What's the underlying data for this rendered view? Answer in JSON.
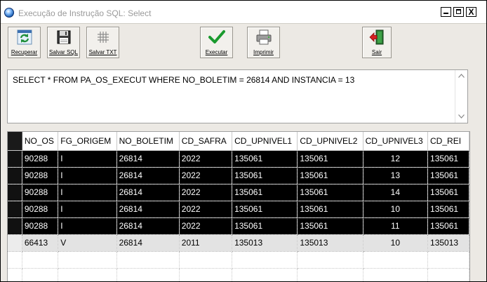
{
  "window": {
    "title": "Execução de Instrução SQL: Select",
    "controls": {
      "minimize": "_",
      "maximize": "□",
      "close": "X"
    }
  },
  "toolbar": {
    "recuperar": {
      "label": "Recuperar",
      "icon": "recycle-icon"
    },
    "salvar_sql": {
      "label": "Salvar SQL",
      "icon": "floppy-disk-icon"
    },
    "salvar_txt": {
      "label": "Salvar TXT",
      "icon": "grid-icon"
    },
    "executar": {
      "label": "Executar",
      "icon": "checkmark-icon"
    },
    "imprimir": {
      "label": "Imprimir",
      "icon": "printer-icon"
    },
    "sair": {
      "label": "Sair",
      "icon": "exit-door-icon"
    }
  },
  "sql": {
    "text": "SELECT * FROM PA_OS_EXECUT WHERE NO_BOLETIM = 26814 AND INSTANCIA = 13"
  },
  "grid": {
    "columns": [
      "NO_OS",
      "FG_ORIGEM",
      "NO_BOLETIM",
      "CD_SAFRA",
      "CD_UPNIVEL1",
      "CD_UPNIVEL2",
      "CD_UPNIVEL3",
      "CD_REI"
    ],
    "rows": [
      [
        "90288",
        "I",
        "26814",
        "2022",
        "135061",
        "135061",
        "12",
        "135061"
      ],
      [
        "90288",
        "I",
        "26814",
        "2022",
        "135061",
        "135061",
        "13",
        "135061"
      ],
      [
        "90288",
        "I",
        "26814",
        "2022",
        "135061",
        "135061",
        "14",
        "135061"
      ],
      [
        "90288",
        "I",
        "26814",
        "2022",
        "135061",
        "135061",
        "10",
        "135061"
      ],
      [
        "90288",
        "I",
        "26814",
        "2022",
        "135061",
        "135061",
        "11",
        "135061"
      ],
      [
        "66413",
        "V",
        "26814",
        "2011",
        "135013",
        "135013",
        "10",
        "135013"
      ]
    ],
    "row_styles": [
      "dark",
      "dark",
      "dark",
      "dark",
      "dark",
      "light"
    ]
  }
}
